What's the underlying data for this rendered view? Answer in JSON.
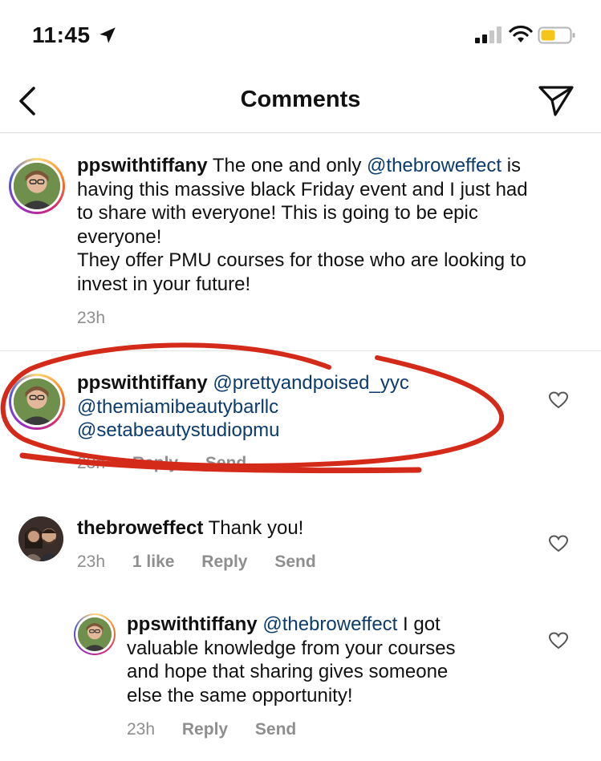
{
  "status": {
    "time": "11:45"
  },
  "nav": {
    "title": "Comments"
  },
  "comments": [
    {
      "username": "ppswithtiffany",
      "lines": [
        [
          {
            "t": "The one and only ",
            "m": false
          },
          {
            "t": "@thebroweffect",
            "m": true
          },
          {
            "t": " is",
            "m": false
          }
        ],
        [
          {
            "t": "having this massive black Friday event and I just had",
            "m": false
          }
        ],
        [
          {
            "t": "to share with everyone! This is going to be epic",
            "m": false
          }
        ],
        [
          {
            "t": "everyone!",
            "m": false
          }
        ],
        [
          {
            "t": "They offer PMU courses for those who are looking to",
            "m": false
          }
        ],
        [
          {
            "t": "invest in your future!",
            "m": false
          }
        ]
      ],
      "time": "23h"
    },
    {
      "username": "ppswithtiffany",
      "lines": [
        [
          {
            "t": "@prettyandpoised_yyc",
            "m": true
          }
        ],
        [
          {
            "t": "@themiamibeautybarllc",
            "m": true
          }
        ],
        [
          {
            "t": "@setabeautystudiopmu",
            "m": true
          }
        ]
      ],
      "time": "23h",
      "reply": "Reply",
      "send": "Send"
    },
    {
      "username": "thebroweffect",
      "lines": [
        [
          {
            "t": "Thank you!",
            "m": false
          }
        ]
      ],
      "time": "23h",
      "likes": "1 like",
      "reply": "Reply",
      "send": "Send"
    },
    {
      "username": "ppswithtiffany",
      "lines": [
        [
          {
            "t": "@thebroweffect",
            "m": true
          },
          {
            "t": " I got",
            "m": false
          }
        ],
        [
          {
            "t": "valuable knowledge from your courses",
            "m": false
          }
        ],
        [
          {
            "t": "and hope that sharing gives someone",
            "m": false
          }
        ],
        [
          {
            "t": "else the same opportunity!",
            "m": false
          }
        ]
      ],
      "time": "23h",
      "reply": "Reply",
      "send": "Send"
    }
  ],
  "icons": {
    "back": "chevron-left-icon",
    "send": "paper-plane-icon",
    "like": "heart-icon",
    "location": "location-arrow-icon",
    "signal": "cellular-signal-icon",
    "wifi": "wifi-icon",
    "battery": "battery-icon"
  },
  "colors": {
    "mention": "#0c3b6e",
    "meta": "#8e8e8e",
    "annotation": "#d42a1a",
    "battery": "#f5c518"
  }
}
